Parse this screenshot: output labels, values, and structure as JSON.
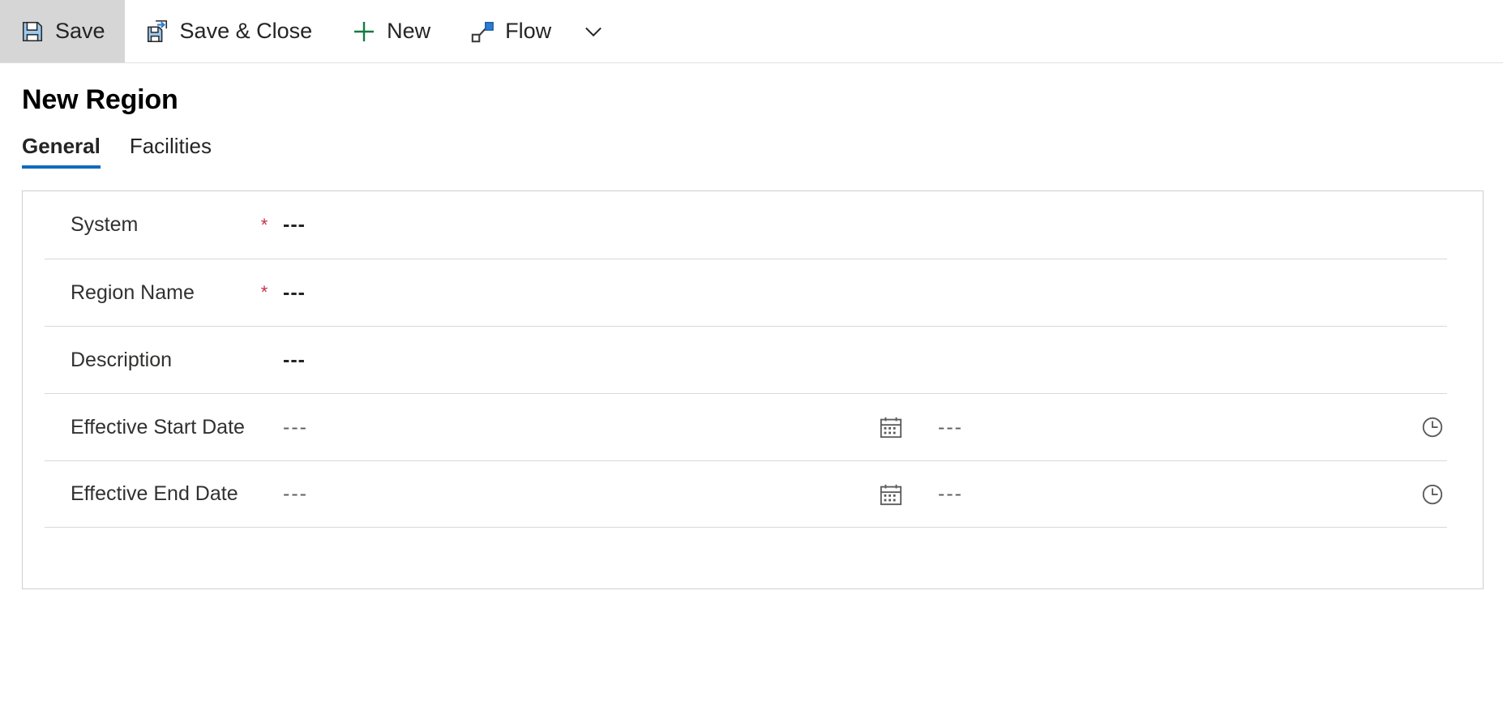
{
  "commandbar": {
    "buttons": [
      {
        "id": "save",
        "label": "Save",
        "icon": "save-floppy-icon",
        "active": true
      },
      {
        "id": "save-close",
        "label": "Save & Close",
        "icon": "save-and-close-icon",
        "active": false
      },
      {
        "id": "new",
        "label": "New",
        "icon": "plus-icon",
        "active": false
      },
      {
        "id": "flow",
        "label": "Flow",
        "icon": "flow-icon",
        "active": false
      }
    ],
    "overflow_icon": "chevron-down-icon"
  },
  "page": {
    "title": "New Region"
  },
  "tabs": [
    {
      "id": "general",
      "label": "General",
      "selected": true
    },
    {
      "id": "facilities",
      "label": "Facilities",
      "selected": false
    }
  ],
  "form": {
    "fields": [
      {
        "id": "system",
        "label": "System",
        "required": true,
        "required_marker": "*",
        "value": "---",
        "type": "text"
      },
      {
        "id": "region-name",
        "label": "Region Name",
        "required": true,
        "required_marker": "*",
        "value": "---",
        "type": "text"
      },
      {
        "id": "description",
        "label": "Description",
        "required": false,
        "required_marker": "",
        "value": "---",
        "type": "text"
      },
      {
        "id": "effective-start-date",
        "label": "Effective Start Date",
        "required": false,
        "required_marker": "",
        "value": "---",
        "time_value": "---",
        "type": "datetime",
        "date_icon": "calendar-icon",
        "time_icon": "clock-icon"
      },
      {
        "id": "effective-end-date",
        "label": "Effective End Date",
        "required": false,
        "required_marker": "",
        "value": "---",
        "time_value": "---",
        "type": "datetime",
        "date_icon": "calendar-icon",
        "time_icon": "clock-icon"
      }
    ]
  },
  "colors": {
    "accent": "#0f6cbd",
    "required": "#c4314b",
    "plus_green": "#107c41",
    "icon_blue": "#2b7cd3",
    "text": "#242424",
    "border": "#cfcfcf",
    "separator": "#d8d8d8",
    "active_button_bg": "#d6d6d6"
  }
}
